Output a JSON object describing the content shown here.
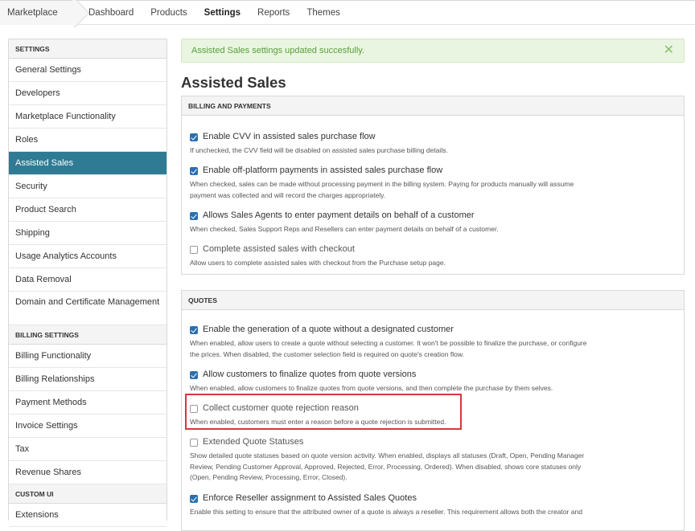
{
  "topnav": {
    "brand": "Marketplace",
    "links": [
      "Dashboard",
      "Products",
      "Settings",
      "Reports",
      "Themes"
    ],
    "active": "Settings"
  },
  "sidebar": {
    "sections": [
      {
        "title": "SETTINGS",
        "items": [
          "General Settings",
          "Developers",
          "Marketplace Functionality",
          "Roles",
          "Assisted Sales",
          "Security",
          "Product Search",
          "Shipping",
          "Usage Analytics Accounts",
          "Data Removal",
          "Domain and Certificate Management"
        ]
      },
      {
        "title": "BILLING SETTINGS",
        "items": [
          "Billing Functionality",
          "Billing Relationships",
          "Payment Methods",
          "Invoice Settings",
          "Tax",
          "Revenue Shares"
        ]
      },
      {
        "title": "CUSTOM UI",
        "items": [
          "Extensions"
        ]
      }
    ],
    "active_item": "Assisted Sales"
  },
  "alert": {
    "message": "Assisted Sales settings updated succesfully.",
    "close_icon": "close-icon"
  },
  "page": {
    "title": "Assisted Sales"
  },
  "billing_panel": {
    "header": "BILLING AND PAYMENTS",
    "options": [
      {
        "label": "Enable CVV in assisted sales purchase flow",
        "checked": true,
        "desc": "If unchecked, the CVV field will be disabled on assisted sales purchase billing details."
      },
      {
        "label": "Enable off-platform payments in assisted sales purchase flow",
        "checked": true,
        "desc1": "When checked, sales can be made without processing payment in the billing system. Paying for products manually will assume",
        "desc2": "payment was collected and will record the charges appropriately."
      },
      {
        "label": "Allows Sales Agents to enter payment details on behalf of a customer",
        "checked": true,
        "desc": "When checked, Sales Support Reps and Resellers can enter payment details on behalf of a customer."
      },
      {
        "label": "Complete assisted sales with checkout",
        "checked": false,
        "desc": "Allow users to complete assisted sales with checkout from the Purchase setup page."
      }
    ]
  },
  "quotes_panel": {
    "header": "QUOTES",
    "options": [
      {
        "label": "Enable the generation of a quote without a designated customer",
        "checked": true,
        "desc1": "When enabled, allow users to create a quote without selecting a customer. It won't be possible to finalize the purchase, or configure",
        "desc2": "the prices. When disabled, the customer selection field is required on quote's creation flow."
      },
      {
        "label": "Allow customers to finalize quotes from quote versions",
        "checked": true,
        "desc": "When enabled, allow customers to finalize quotes from quote versions, and then complete the purchase by them selves."
      },
      {
        "label": "Collect customer quote rejection reason",
        "checked": false,
        "desc": "When enabled, customers must enter a reason before a quote rejection is submitted."
      },
      {
        "label": "Extended Quote Statuses",
        "checked": false,
        "desc1": "Show detailed quote statuses based on quote version activity. When enabled, displays all statuses (Draft, Open, Pending Manager",
        "desc2": "Review, Pending Customer Approval, Approved, Rejected, Error, Processing, Ordered). When disabled, shows core statuses only",
        "desc3": "(Open, Pending Review, Processing, Error, Closed)."
      },
      {
        "label": "Enforce Reseller assignment to Assisted Sales Quotes",
        "checked": true,
        "desc": "Enable this setting to ensure that the attributed owner of a quote is always a reseller. This requirement allows both the creator and"
      }
    ]
  },
  "colors": {
    "accent": "#2f7b94",
    "checkbox": "#2a6fb0",
    "success_text": "#57a13a",
    "highlight_border": "#d9363e"
  }
}
